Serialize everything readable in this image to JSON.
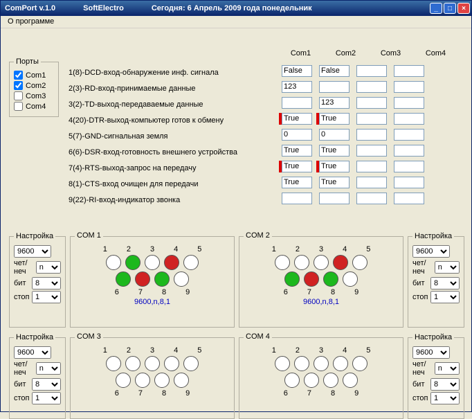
{
  "title": {
    "app": "ComPort v.1.0",
    "vendor": "SoftElectro",
    "date": "Сегодня: 6 Апрель 2009 года понедельник"
  },
  "menu": {
    "about": "О программе"
  },
  "ports_group": {
    "legend": "Порты",
    "items": [
      {
        "label": "Com1",
        "checked": true
      },
      {
        "label": "Com2",
        "checked": true
      },
      {
        "label": "Com3",
        "checked": false
      },
      {
        "label": "Com4",
        "checked": false
      }
    ]
  },
  "pins": [
    "1(8)-DCD-вход-обнаружение инф. сигнала",
    "2(3)-RD-вход-принимаемые данные",
    "3(2)-TD-выход-передаваемые данные",
    "4(20)-DTR-выход-компьютер готов к обмену",
    "5(7)-GND-сигнальная земля",
    "6(6)-DSR-вход-готовность внешнего устройства",
    "7(4)-RTS-выход-запрос на передачу",
    "8(1)-CTS-вход очищен для передачи",
    "9(22)-RI-вход-индикатор звонка"
  ],
  "headers": [
    "Com1",
    "Com2",
    "Com3",
    "Com4"
  ],
  "grid": [
    [
      {
        "v": "False",
        "led": false
      },
      {
        "v": "False",
        "led": false
      },
      {
        "v": "",
        "led": false
      },
      {
        "v": "",
        "led": false
      }
    ],
    [
      {
        "v": "123",
        "led": false
      },
      {
        "v": "",
        "led": false
      },
      {
        "v": "",
        "led": false
      },
      {
        "v": "",
        "led": false
      }
    ],
    [
      {
        "v": "",
        "led": false
      },
      {
        "v": "123",
        "led": false
      },
      {
        "v": "",
        "led": false
      },
      {
        "v": "",
        "led": false
      }
    ],
    [
      {
        "v": "True",
        "led": true
      },
      {
        "v": "True",
        "led": true
      },
      {
        "v": "",
        "led": false
      },
      {
        "v": "",
        "led": false
      }
    ],
    [
      {
        "v": "0",
        "led": false
      },
      {
        "v": "0",
        "led": false
      },
      {
        "v": "",
        "led": false
      },
      {
        "v": "",
        "led": false
      }
    ],
    [
      {
        "v": "True",
        "led": false
      },
      {
        "v": "True",
        "led": false
      },
      {
        "v": "",
        "led": false
      },
      {
        "v": "",
        "led": false
      }
    ],
    [
      {
        "v": "True",
        "led": true
      },
      {
        "v": "True",
        "led": true
      },
      {
        "v": "",
        "led": false
      },
      {
        "v": "",
        "led": false
      }
    ],
    [
      {
        "v": "True",
        "led": false
      },
      {
        "v": "True",
        "led": false
      },
      {
        "v": "",
        "led": false
      },
      {
        "v": "",
        "led": false
      }
    ],
    [
      {
        "v": "",
        "led": false
      },
      {
        "v": "",
        "led": false
      },
      {
        "v": "",
        "led": false
      },
      {
        "v": "",
        "led": false
      }
    ]
  ],
  "settings_labels": {
    "legend": "Настройка",
    "parity": "чет/неч",
    "bits": "бит",
    "stop": "стоп"
  },
  "settings": [
    {
      "baud": "9600",
      "parity": "n",
      "bits": "8",
      "stop": "1"
    },
    {
      "baud": "9600",
      "parity": "n",
      "bits": "8",
      "stop": "1"
    },
    {
      "baud": "9600",
      "parity": "n",
      "bits": "8",
      "stop": "1"
    },
    {
      "baud": "9600",
      "parity": "n",
      "bits": "8",
      "stop": "1"
    }
  ],
  "com_groups": [
    {
      "title": "COM 1",
      "nums_top": [
        "1",
        "2",
        "3",
        "4",
        "5"
      ],
      "nums_bot": [
        "6",
        "7",
        "8",
        "9"
      ],
      "top": [
        "w",
        "g",
        "w",
        "r",
        "w"
      ],
      "bot": [
        "g",
        "r",
        "g",
        "w"
      ],
      "summary": "9600,n,8,1"
    },
    {
      "title": "COM 2",
      "nums_top": [
        "1",
        "2",
        "3",
        "4",
        "5"
      ],
      "nums_bot": [
        "6",
        "7",
        "8",
        "9"
      ],
      "top": [
        "w",
        "w",
        "w",
        "r",
        "w"
      ],
      "bot": [
        "g",
        "r",
        "g",
        "w"
      ],
      "summary": "9600,n,8,1"
    },
    {
      "title": "COM 3",
      "nums_top": [
        "1",
        "2",
        "3",
        "4",
        "5"
      ],
      "nums_bot": [
        "6",
        "7",
        "8",
        "9"
      ],
      "top": [
        "w",
        "w",
        "w",
        "w",
        "w"
      ],
      "bot": [
        "w",
        "w",
        "w",
        "w"
      ],
      "summary": ""
    },
    {
      "title": "COM 4",
      "nums_top": [
        "1",
        "2",
        "3",
        "4",
        "5"
      ],
      "nums_bot": [
        "6",
        "7",
        "8",
        "9"
      ],
      "top": [
        "w",
        "w",
        "w",
        "w",
        "w"
      ],
      "bot": [
        "w",
        "w",
        "w",
        "w"
      ],
      "summary": ""
    }
  ]
}
